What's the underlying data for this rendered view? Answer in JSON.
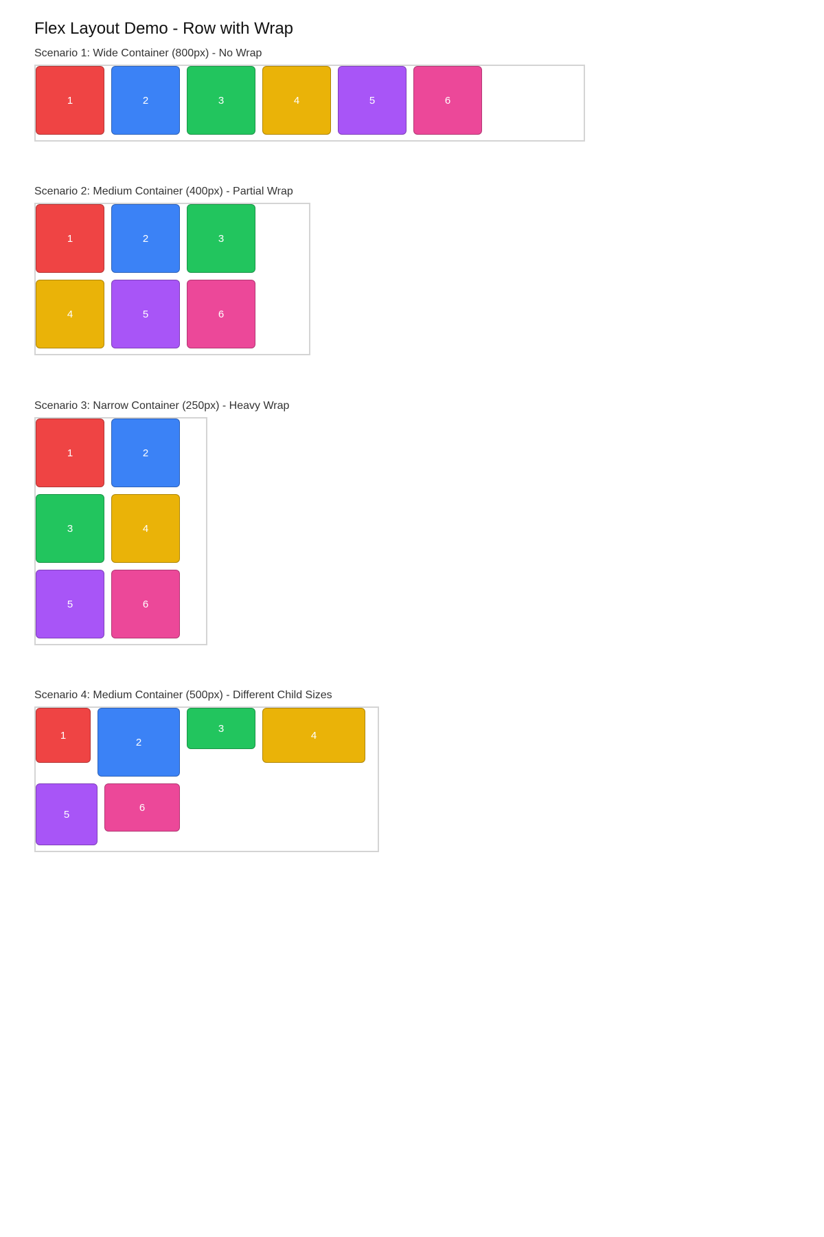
{
  "title": "Flex Layout Demo - Row with Wrap",
  "scenarios": [
    {
      "label": "Scenario 1: Wide Container (800px) - No Wrap",
      "items": [
        "1",
        "2",
        "3",
        "4",
        "5",
        "6"
      ]
    },
    {
      "label": "Scenario 2: Medium Container (400px) - Partial Wrap",
      "items": [
        "1",
        "2",
        "3",
        "4",
        "5",
        "6"
      ]
    },
    {
      "label": "Scenario 3: Narrow Container (250px) - Heavy Wrap",
      "items": [
        "1",
        "2",
        "3",
        "4",
        "5",
        "6"
      ]
    },
    {
      "label": "Scenario 4: Medium Container (500px) - Different Child Sizes",
      "items": [
        "1",
        "2",
        "3",
        "4",
        "5",
        "6"
      ]
    }
  ],
  "colors": {
    "item_1": "#ef4444",
    "item_2": "#3b82f6",
    "item_3": "#22c55e",
    "item_4": "#eab308",
    "item_5": "#a855f7",
    "item_6": "#ec4899",
    "container_border": "#d4d4d4"
  }
}
